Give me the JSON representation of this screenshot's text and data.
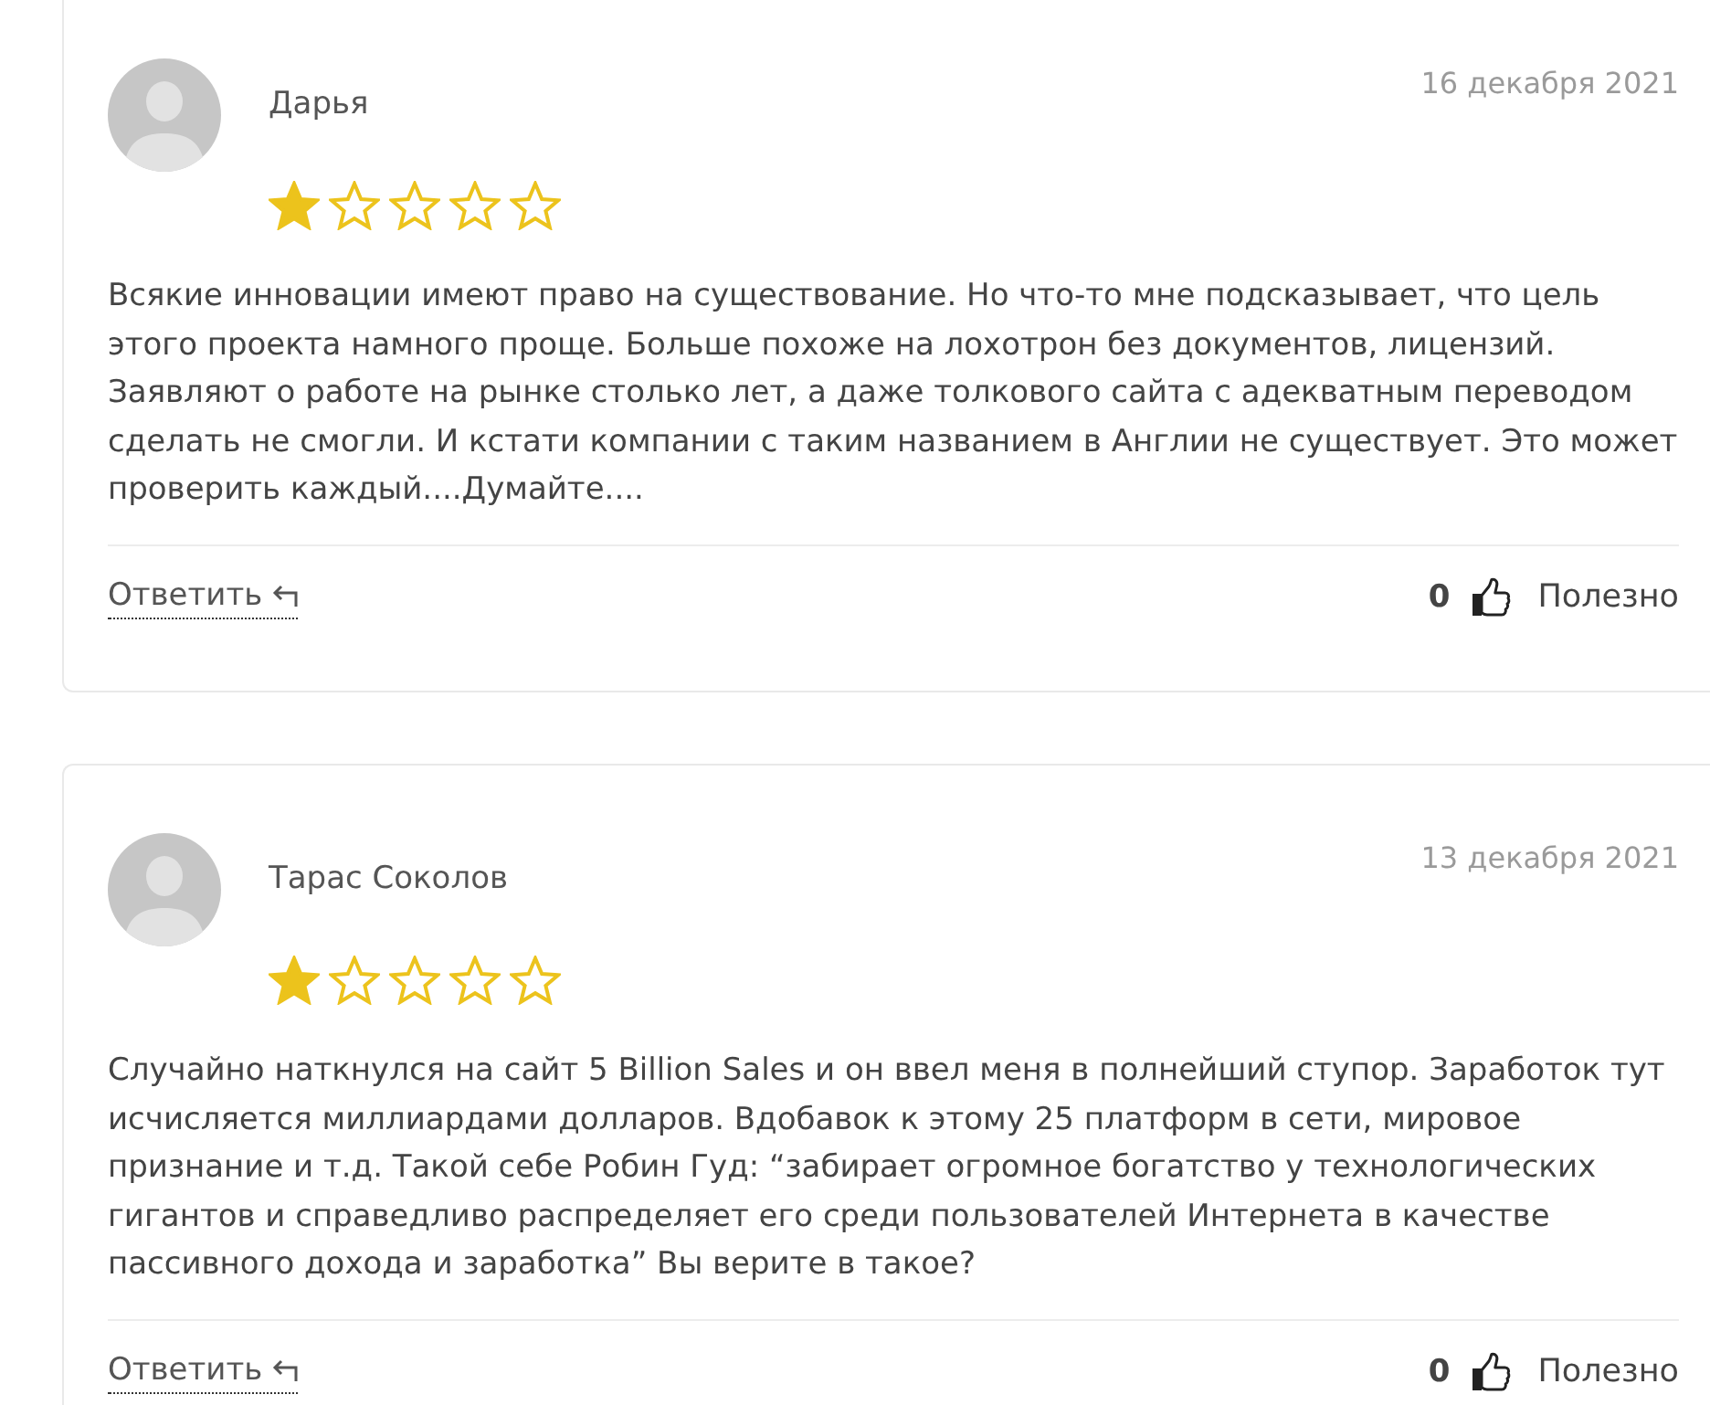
{
  "reviews": [
    {
      "author": "Дарья",
      "date": "16 декабря 2021",
      "stars": 1,
      "text": "Всякие инновации имеют право на существование. Но что-то мне подсказывает, что цель этого проекта намного проще. Больше похоже на лохотрон без документов, лицензий. Заявляют о работе на рынке столько лет, а даже толкового сайта с адекватным переводом сделать не смогли. И кстати компании с таким названием в Англии не существует. Это может проверить каждый....Думайте....",
      "reply_label": "Ответить",
      "helpful_count": "0",
      "helpful_label": "Полезно"
    },
    {
      "author": "Тарас Соколов",
      "date": "13 декабря 2021",
      "stars": 1,
      "text": "Случайно наткнулся на сайт 5 Billion Sales и он ввел меня в полнейший ступор. Заработок тут исчисляется миллиардами долларов. Вдобавок к этому 25 платформ в сети, мировое признание и т.д. Такой себе Робин Гуд: “забирает огромное богатство у технологических гигантов и справедливо распределяет его среди пользователей Интернета в качестве пассивного дохода и заработка” Вы верите в такое?",
      "reply_label": "Ответить",
      "helpful_count": "0",
      "helpful_label": "Полезно"
    }
  ]
}
